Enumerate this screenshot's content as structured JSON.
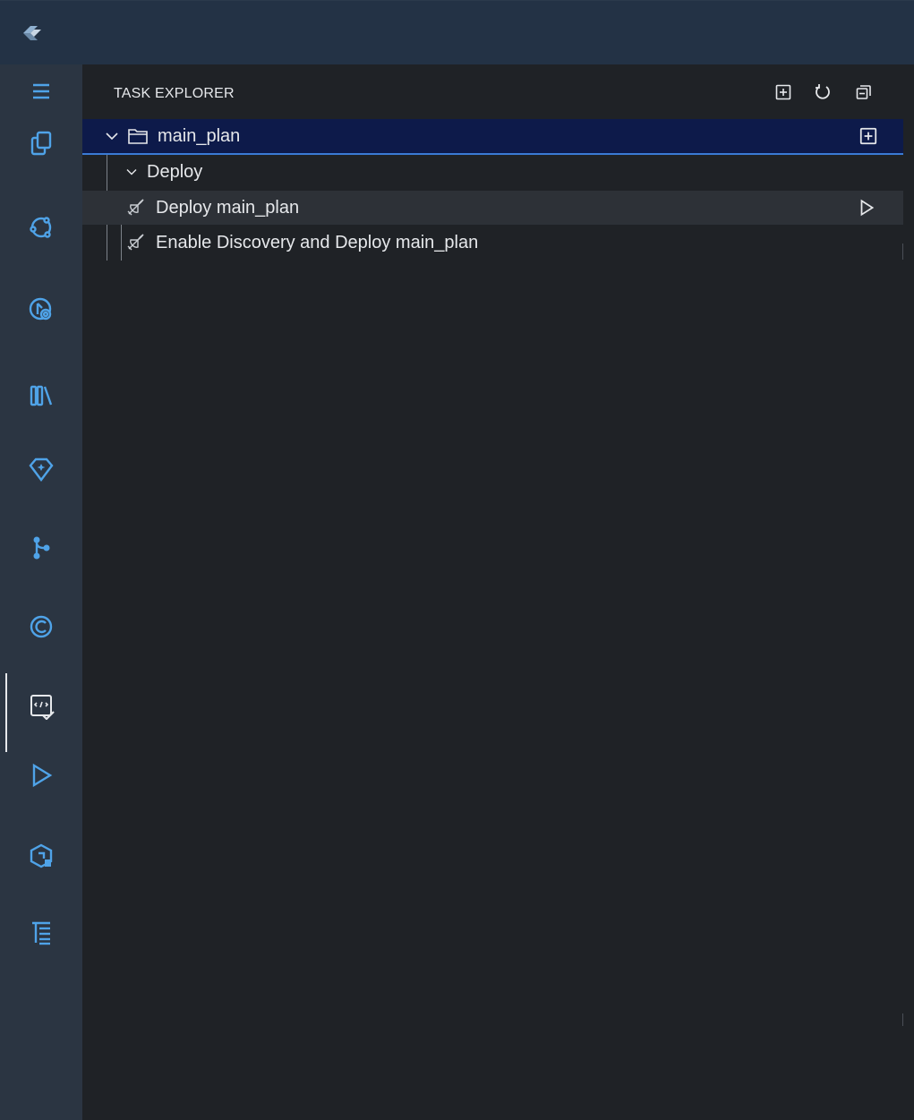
{
  "panel": {
    "title": "TASK EXPLORER",
    "header_actions": [
      "new-task-icon",
      "refresh-icon",
      "collapse-all-icon"
    ]
  },
  "activity_bar": {
    "items": [
      {
        "icon": "menu-icon"
      },
      {
        "icon": "explorer-icon"
      },
      {
        "icon": "integrations-icon"
      },
      {
        "icon": "deploy-monitor-icon"
      },
      {
        "icon": "library-icon"
      },
      {
        "icon": "gem-icon"
      },
      {
        "icon": "source-control-icon"
      },
      {
        "icon": "copyright-icon"
      },
      {
        "icon": "task-explorer-icon"
      },
      {
        "icon": "run-icon"
      },
      {
        "icon": "extensions-icon"
      },
      {
        "icon": "outline-icon"
      }
    ],
    "active": "task-explorer-icon"
  },
  "tree": {
    "root": {
      "label": "main_plan"
    },
    "group": {
      "label": "Deploy"
    },
    "tasks": [
      {
        "label": "Deploy main_plan"
      },
      {
        "label": "Enable Discovery and Deploy main_plan"
      }
    ]
  },
  "colors": {
    "titlebar": "#233245",
    "activity_bar": "#2b3542",
    "panel": "#1f2226",
    "selection": "#0d1a4a",
    "focus_border": "#3a7bd5",
    "icon_accent": "#4fa3e8"
  }
}
